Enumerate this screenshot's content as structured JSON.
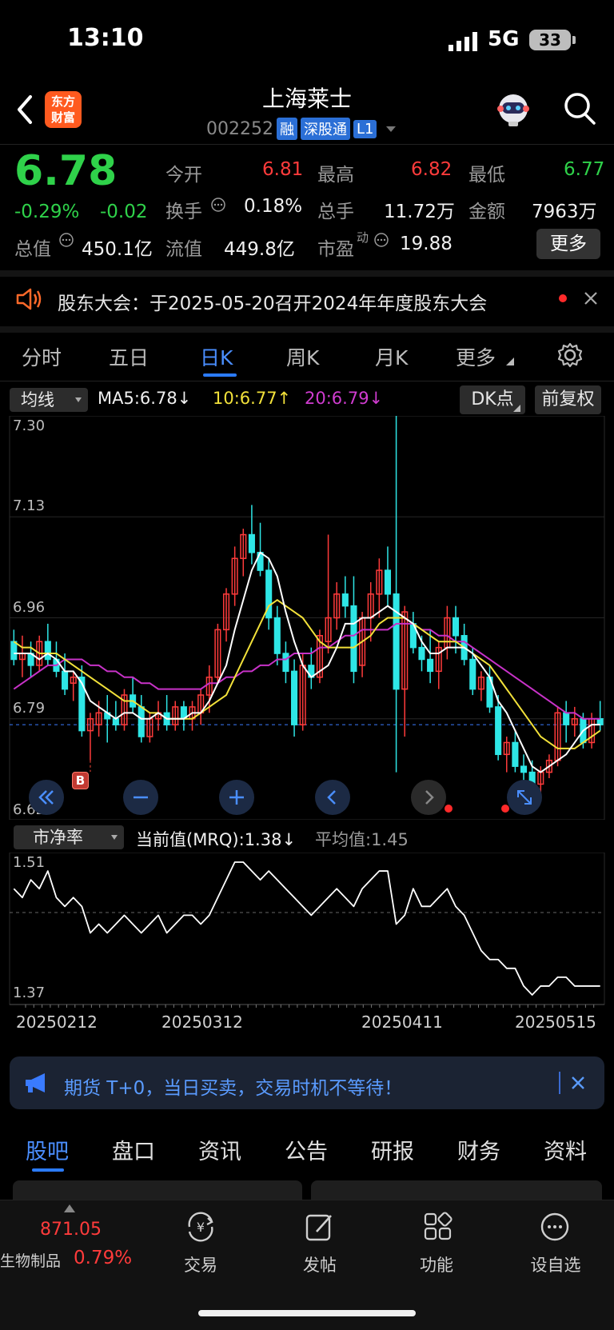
{
  "status": {
    "time": "13:10",
    "network": "5G",
    "battery": "33"
  },
  "header": {
    "logo_line1": "东方",
    "logo_line2": "财富",
    "stock_name": "上海莱士",
    "stock_code": "002252",
    "tags": [
      "融",
      "深股通",
      "L1"
    ]
  },
  "quote": {
    "price": "6.78",
    "change_pct": "-0.29%",
    "change": "-0.02",
    "open_label": "今开",
    "open": "6.81",
    "high_label": "最高",
    "high": "6.82",
    "low_label": "最低",
    "low": "6.77",
    "turnover_label": "换手",
    "turnover": "0.18%",
    "volume_label": "总手",
    "volume": "11.72万",
    "amount_label": "金额",
    "amount": "7963万",
    "mktcap_label": "总值",
    "mktcap": "450.1亿",
    "float_label": "流值",
    "float": "449.8亿",
    "pe_label": "市盈",
    "pe_sup": "动",
    "pe": "19.88",
    "more_label": "更多"
  },
  "notice": {
    "text": "股东大会：于2025-05-20召开2024年年度股东大会"
  },
  "chart_tabs": [
    "分时",
    "五日",
    "日K",
    "周K",
    "月K",
    "更多"
  ],
  "ma_bar": {
    "selector": "均线",
    "ma5": "MA5:6.78↓",
    "ma10": "10:6.77↑",
    "ma20": "20:6.79↓",
    "dk_label": "DK点",
    "fq_label": "前复权"
  },
  "colors": {
    "up": "#ff3b3b",
    "down": "#2ee6e6",
    "ma5": "#ffffff",
    "ma10": "#f2e13a",
    "ma20": "#c832c8",
    "accent": "#2b7bff"
  },
  "chart_data": [
    {
      "type": "candlestick",
      "y_ticks": [
        "7.30",
        "7.13",
        "6.96",
        "6.79",
        "6.62"
      ],
      "ylim": [
        6.62,
        7.3
      ],
      "current_price_line": 6.78,
      "marker": "B",
      "ohlc": [
        [
          6.92,
          6.94,
          6.88,
          6.89
        ],
        [
          6.89,
          6.93,
          6.86,
          6.9
        ],
        [
          6.9,
          6.92,
          6.86,
          6.88
        ],
        [
          6.88,
          6.93,
          6.87,
          6.92
        ],
        [
          6.92,
          6.95,
          6.88,
          6.89
        ],
        [
          6.89,
          6.92,
          6.86,
          6.87
        ],
        [
          6.87,
          6.9,
          6.83,
          6.84
        ],
        [
          6.85,
          6.87,
          6.82,
          6.86
        ],
        [
          6.86,
          6.88,
          6.76,
          6.77
        ],
        [
          6.77,
          6.8,
          6.72,
          6.79
        ],
        [
          6.78,
          6.82,
          6.76,
          6.8
        ],
        [
          6.8,
          6.83,
          6.75,
          6.79
        ],
        [
          6.79,
          6.82,
          6.77,
          6.78
        ],
        [
          6.78,
          6.84,
          6.77,
          6.83
        ],
        [
          6.83,
          6.86,
          6.8,
          6.81
        ],
        [
          6.81,
          6.83,
          6.75,
          6.76
        ],
        [
          6.76,
          6.8,
          6.75,
          6.79
        ],
        [
          6.79,
          6.82,
          6.77,
          6.8
        ],
        [
          6.8,
          6.83,
          6.77,
          6.78
        ],
        [
          6.78,
          6.82,
          6.77,
          6.81
        ],
        [
          6.81,
          6.82,
          6.77,
          6.79
        ],
        [
          6.79,
          6.82,
          6.77,
          6.81
        ],
        [
          6.8,
          6.84,
          6.78,
          6.83
        ],
        [
          6.83,
          6.88,
          6.8,
          6.86
        ],
        [
          6.86,
          6.95,
          6.85,
          6.94
        ],
        [
          6.94,
          7.01,
          6.92,
          7.0
        ],
        [
          7.0,
          7.08,
          6.98,
          7.06
        ],
        [
          7.06,
          7.11,
          7.03,
          7.1
        ],
        [
          7.1,
          7.15,
          7.05,
          7.07
        ],
        [
          7.07,
          7.12,
          7.03,
          7.04
        ],
        [
          7.04,
          7.06,
          6.94,
          6.96
        ],
        [
          6.96,
          6.98,
          6.88,
          6.9
        ],
        [
          6.9,
          6.92,
          6.85,
          6.87
        ],
        [
          6.87,
          6.89,
          6.76,
          6.78
        ],
        [
          6.78,
          6.9,
          6.77,
          6.88
        ],
        [
          6.88,
          6.91,
          6.84,
          6.86
        ],
        [
          6.86,
          6.94,
          6.85,
          6.93
        ],
        [
          6.92,
          7.1,
          6.9,
          6.96
        ],
        [
          6.96,
          7.02,
          6.94,
          7.0
        ],
        [
          7.0,
          7.03,
          6.96,
          6.98
        ],
        [
          6.98,
          7.03,
          6.85,
          6.87
        ],
        [
          6.88,
          6.97,
          6.86,
          6.96
        ],
        [
          6.96,
          7.02,
          6.92,
          7.0
        ],
        [
          7.0,
          7.06,
          6.96,
          7.04
        ],
        [
          7.04,
          7.08,
          6.98,
          7.0
        ],
        [
          7.0,
          7.3,
          6.7,
          6.84
        ],
        [
          6.84,
          6.98,
          6.76,
          6.97
        ],
        [
          6.95,
          6.97,
          6.9,
          6.91
        ],
        [
          6.91,
          6.93,
          6.87,
          6.89
        ],
        [
          6.89,
          6.94,
          6.85,
          6.87
        ],
        [
          6.87,
          6.92,
          6.84,
          6.91
        ],
        [
          6.91,
          6.98,
          6.89,
          6.96
        ],
        [
          6.96,
          6.98,
          6.9,
          6.93
        ],
        [
          6.93,
          6.95,
          6.88,
          6.89
        ],
        [
          6.89,
          6.91,
          6.83,
          6.84
        ],
        [
          6.84,
          6.87,
          6.82,
          6.86
        ],
        [
          6.86,
          6.88,
          6.8,
          6.81
        ],
        [
          6.81,
          6.83,
          6.72,
          6.73
        ],
        [
          6.73,
          6.76,
          6.7,
          6.75
        ],
        [
          6.75,
          6.77,
          6.7,
          6.71
        ],
        [
          6.71,
          6.73,
          6.67,
          6.7
        ],
        [
          6.7,
          6.72,
          6.66,
          6.68
        ],
        [
          6.68,
          6.71,
          6.66,
          6.7
        ],
        [
          6.7,
          6.73,
          6.69,
          6.72
        ],
        [
          6.72,
          6.81,
          6.71,
          6.8
        ],
        [
          6.8,
          6.82,
          6.75,
          6.78
        ],
        [
          6.78,
          6.81,
          6.76,
          6.79
        ],
        [
          6.79,
          6.8,
          6.74,
          6.75
        ],
        [
          6.75,
          6.8,
          6.74,
          6.79
        ],
        [
          6.79,
          6.82,
          6.77,
          6.78
        ]
      ],
      "ma5": [
        6.9,
        6.9,
        6.9,
        6.89,
        6.9,
        6.89,
        6.87,
        6.87,
        6.85,
        6.82,
        6.81,
        6.8,
        6.79,
        6.8,
        6.8,
        6.79,
        6.79,
        6.8,
        6.79,
        6.79,
        6.79,
        6.8,
        6.8,
        6.82,
        6.85,
        6.88,
        6.94,
        6.99,
        7.04,
        7.07,
        7.06,
        7.03,
        6.97,
        6.92,
        6.88,
        6.86,
        6.87,
        6.88,
        6.91,
        6.95,
        6.95,
        6.96,
        6.96,
        6.97,
        6.98,
        6.97,
        6.96,
        6.95,
        6.92,
        6.9,
        6.9,
        6.91,
        6.91,
        6.91,
        6.9,
        6.88,
        6.86,
        6.82,
        6.8,
        6.77,
        6.74,
        6.71,
        6.7,
        6.71,
        6.72,
        6.73,
        6.75,
        6.77,
        6.78,
        6.78
      ],
      "ma10": [
        6.92,
        6.91,
        6.91,
        6.9,
        6.9,
        6.9,
        6.89,
        6.88,
        6.87,
        6.86,
        6.85,
        6.84,
        6.83,
        6.82,
        6.82,
        6.81,
        6.8,
        6.8,
        6.79,
        6.79,
        6.79,
        6.79,
        6.8,
        6.81,
        6.82,
        6.83,
        6.86,
        6.89,
        6.92,
        6.95,
        6.98,
        6.99,
        6.98,
        6.97,
        6.96,
        6.94,
        6.92,
        6.91,
        6.91,
        6.91,
        6.91,
        6.92,
        6.93,
        6.95,
        6.96,
        6.96,
        6.96,
        6.95,
        6.94,
        6.93,
        6.92,
        6.92,
        6.92,
        6.91,
        6.9,
        6.89,
        6.88,
        6.86,
        6.84,
        6.82,
        6.8,
        6.78,
        6.76,
        6.75,
        6.74,
        6.74,
        6.74,
        6.75,
        6.76,
        6.77
      ],
      "ma20": [
        6.84,
        6.85,
        6.86,
        6.87,
        6.88,
        6.88,
        6.89,
        6.89,
        6.89,
        6.88,
        6.88,
        6.87,
        6.87,
        6.86,
        6.86,
        6.85,
        6.85,
        6.84,
        6.84,
        6.84,
        6.84,
        6.84,
        6.84,
        6.85,
        6.85,
        6.86,
        6.86,
        6.87,
        6.87,
        6.88,
        6.88,
        6.89,
        6.89,
        6.9,
        6.9,
        6.9,
        6.91,
        6.91,
        6.92,
        6.93,
        6.93,
        6.94,
        6.94,
        6.94,
        6.94,
        6.95,
        6.95,
        6.95,
        6.94,
        6.94,
        6.93,
        6.93,
        6.92,
        6.92,
        6.91,
        6.9,
        6.89,
        6.88,
        6.87,
        6.86,
        6.85,
        6.84,
        6.83,
        6.82,
        6.81,
        6.8,
        6.8,
        6.79,
        6.79,
        6.79
      ]
    },
    {
      "type": "line",
      "y_ticks": [
        "1.51",
        "1.37"
      ],
      "ylim": [
        1.37,
        1.51
      ],
      "x_tick_labels": [
        "20250212",
        "20250312",
        "20250411",
        "20250515"
      ],
      "values": [
        1.49,
        1.48,
        1.5,
        1.49,
        1.51,
        1.48,
        1.47,
        1.48,
        1.47,
        1.44,
        1.45,
        1.44,
        1.45,
        1.46,
        1.45,
        1.44,
        1.45,
        1.46,
        1.44,
        1.45,
        1.46,
        1.46,
        1.45,
        1.46,
        1.48,
        1.5,
        1.52,
        1.52,
        1.51,
        1.5,
        1.51,
        1.5,
        1.49,
        1.48,
        1.47,
        1.46,
        1.47,
        1.48,
        1.49,
        1.48,
        1.47,
        1.49,
        1.5,
        1.51,
        1.51,
        1.45,
        1.46,
        1.49,
        1.47,
        1.47,
        1.48,
        1.49,
        1.47,
        1.46,
        1.44,
        1.42,
        1.41,
        1.41,
        1.4,
        1.4,
        1.38,
        1.37,
        1.38,
        1.38,
        1.39,
        1.39,
        1.38,
        1.38,
        1.38,
        1.38
      ]
    }
  ],
  "pb_bar": {
    "selector": "市净率",
    "current": "当前值(MRQ):1.38↓",
    "average": "平均值:1.45"
  },
  "ad": {
    "text": "期货 T+0，当日买卖，交易时机不等待！"
  },
  "bottom_tabs": [
    "股吧",
    "盘口",
    "资讯",
    "公告",
    "研报",
    "财务",
    "资料"
  ],
  "bottom_nav": {
    "index_value": "871.05",
    "index_name": "生物制品",
    "index_change": "0.79%",
    "items": [
      "交易",
      "发帖",
      "功能",
      "设自选"
    ]
  }
}
